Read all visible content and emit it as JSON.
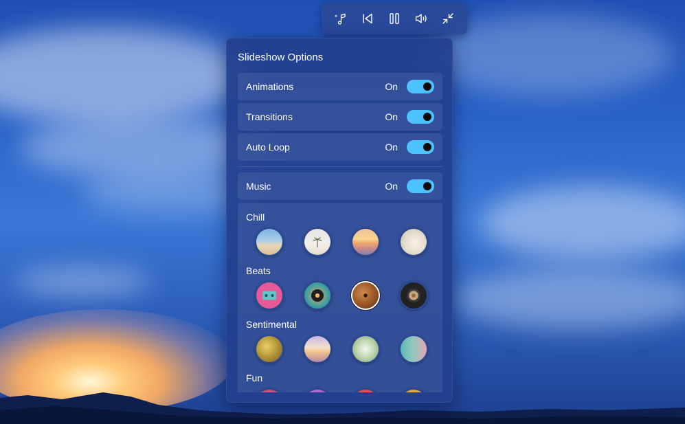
{
  "toolbar": {
    "buttons": [
      {
        "name": "music-edit-button",
        "icon": "sparkle-music-icon"
      },
      {
        "name": "previous-button",
        "icon": "previous-icon"
      },
      {
        "name": "pause-button",
        "icon": "pause-icon"
      },
      {
        "name": "volume-button",
        "icon": "volume-icon"
      },
      {
        "name": "exit-fullscreen-button",
        "icon": "collapse-icon"
      }
    ]
  },
  "panel": {
    "title": "Slideshow Options",
    "settings": [
      {
        "label": "Animations",
        "state": "On",
        "enabled": true
      },
      {
        "label": "Transitions",
        "state": "On",
        "enabled": true
      },
      {
        "label": "Auto Loop",
        "state": "On",
        "enabled": true
      }
    ],
    "music": {
      "label": "Music",
      "state": "On",
      "enabled": true
    },
    "categories": [
      {
        "label": "Chill",
        "selected_index": -1,
        "tracks": [
          "beach-thumbnail",
          "palm-tree-thumbnail",
          "sunset-thumbnail",
          "coffee-cup-thumbnail"
        ]
      },
      {
        "label": "Beats",
        "selected_index": 2,
        "tracks": [
          "cassette-thumbnail",
          "turntable-thumbnail",
          "vinyl-record-thumbnail",
          "speaker-thumbnail"
        ]
      },
      {
        "label": "Sentimental",
        "selected_index": -1,
        "tracks": [
          "golden-bokeh-thumbnail",
          "lavender-sunrise-thumbnail",
          "green-blur-thumbnail",
          "teal-pink-thumbnail"
        ]
      },
      {
        "label": "Fun",
        "selected_index": -1,
        "tracks": [
          "fun-thumbnail-1",
          "fun-thumbnail-2",
          "fun-thumbnail-3",
          "fun-thumbnail-4"
        ]
      }
    ]
  },
  "colors": {
    "accent": "#4cc2ff",
    "panel_bg": "#22408e",
    "toolbar_bg": "#2a4896"
  }
}
